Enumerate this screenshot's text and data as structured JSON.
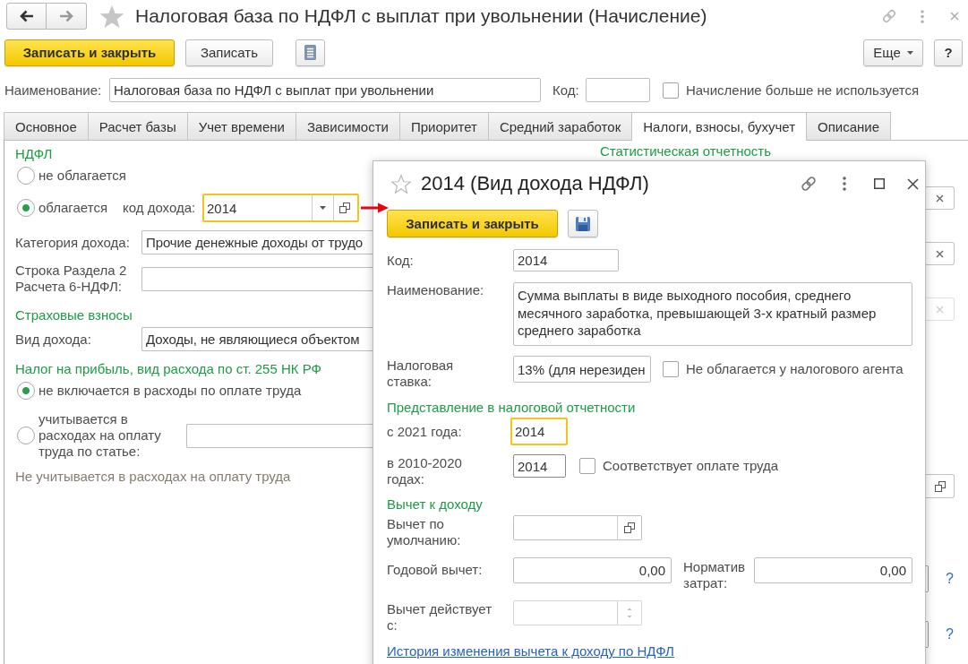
{
  "window": {
    "title": "Налоговая база по НДФЛ с выплат при увольнении (Начисление)",
    "back": {
      "disabled": false
    },
    "forward": {
      "disabled": true
    }
  },
  "toolbar": {
    "save_close": "Записать и закрыть",
    "save": "Записать",
    "more": "Еще",
    "help": "?"
  },
  "header": {
    "name_label": "Наименование:",
    "name_value": "Налоговая база по НДФЛ с выплат при увольнении",
    "code_label": "Код:",
    "inactive": {
      "label": "Начисление больше не используется",
      "checked": false
    }
  },
  "tabs": [
    {
      "label": "Основное",
      "selected": false
    },
    {
      "label": "Расчет базы",
      "selected": false
    },
    {
      "label": "Учет времени",
      "selected": false
    },
    {
      "label": "Зависимости",
      "selected": false
    },
    {
      "label": "Приоритет",
      "selected": false
    },
    {
      "label": "Средний заработок",
      "selected": false
    },
    {
      "label": "Налоги, взносы, бухучет",
      "selected": true
    },
    {
      "label": "Описание",
      "selected": false
    }
  ],
  "ndfl": {
    "title": "НДФЛ",
    "options": [
      {
        "label": "не облагается",
        "selected": false
      },
      {
        "label": "облагается",
        "selected": true
      }
    ],
    "income_code": {
      "label": "код дохода:",
      "value": "2014",
      "highlighted": true
    },
    "category": {
      "label": "Категория дохода:",
      "value": "Прочие денежные доходы от трудо"
    },
    "report_line": {
      "label": "Строка Раздела 2 Расчета 6-НДФЛ:"
    }
  },
  "insurance": {
    "title": "Страховые взносы",
    "income_type": {
      "label": "Вид дохода:",
      "value": "Доходы, не являющиеся объектом"
    }
  },
  "profit_tax": {
    "title": "Налог на прибыль, вид расхода по ст. 255 НК РФ",
    "options": [
      {
        "label": "не включается в расходы по оплате труда",
        "selected": true
      },
      {
        "label": "учитывается в расходах на оплату труда по статье:",
        "selected": false
      }
    ],
    "note": "Не учитывается в расходах на оплату труда"
  },
  "statistics": {
    "title": "Статистическая отчетность",
    "clear_buttons": [
      {
        "disabled": false
      },
      {
        "disabled": false
      },
      {
        "disabled": true
      }
    ],
    "help_links": [
      "?",
      "?"
    ]
  },
  "dialog": {
    "title": "2014 (Вид дохода НДФЛ)",
    "save_close": "Записать и закрыть",
    "code": {
      "label": "Код:",
      "value": "2014"
    },
    "name": {
      "label": "Наименование:",
      "value": "Сумма выплаты в виде выходного пособия, среднего месячного заработка, превышающей 3-х кратный размер среднего заработка"
    },
    "rate": {
      "label": "Налоговая ставка:",
      "value": "13% (для нерезиден"
    },
    "not_taxed": {
      "label": "Не облагается у налогового агента",
      "checked": false
    },
    "reporting": {
      "title": "Представление в налоговой отчетности",
      "from_2021": {
        "label": "с 2021 года:",
        "value": "2014",
        "highlighted": true
      },
      "y2010": {
        "label": "в 2010-2020 годах:",
        "value": "2014"
      },
      "labor": {
        "label": "Соответствует оплате труда",
        "checked": false
      }
    },
    "deduction": {
      "title": "Вычет к доходу",
      "default_label": "Вычет по умолчанию:",
      "annual": {
        "label": "Годовой вычет:",
        "value": "0,00"
      },
      "norm": {
        "label": "Норматив затрат:",
        "value": "0,00"
      },
      "valid_from_label": "Вычет действует с:"
    },
    "history_link": "История изменения вычета к доходу по НДФЛ"
  }
}
